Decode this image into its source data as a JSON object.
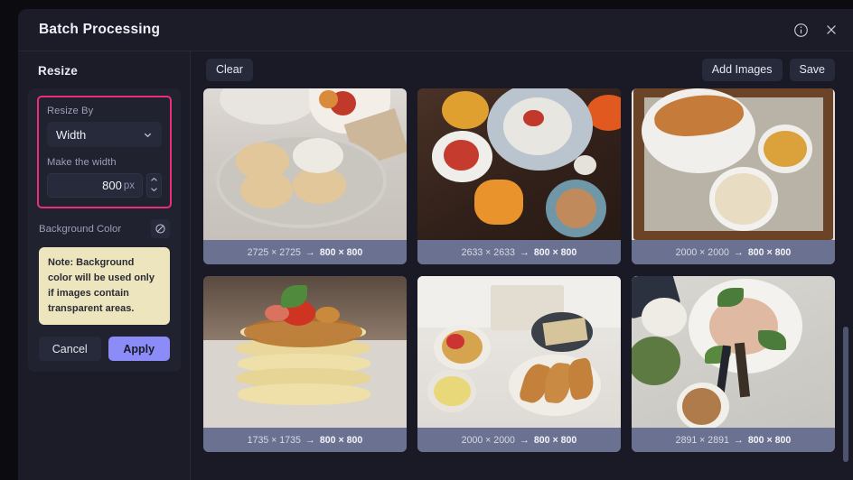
{
  "window": {
    "title": "Batch Processing",
    "info_icon": "info-circle-icon",
    "close_icon": "close-icon"
  },
  "sidebar": {
    "heading": "Resize",
    "resize_by": {
      "label": "Resize By",
      "selected": "Width",
      "chevron_icon": "chevron-down-icon"
    },
    "width_field": {
      "label": "Make the width",
      "value": "800",
      "unit": "px",
      "stepper_up_icon": "chevron-up-icon",
      "stepper_down_icon": "chevron-down-icon"
    },
    "background_color": {
      "label": "Background Color",
      "swatch_icon": "no-color-icon"
    },
    "note": "Note: Background color will be used only if images contain transparent areas.",
    "cancel_label": "Cancel",
    "apply_label": "Apply"
  },
  "toolbar": {
    "clear_label": "Clear",
    "add_images_label": "Add Images",
    "save_label": "Save"
  },
  "grid": {
    "arrow": "→",
    "items": [
      {
        "source": "2725 × 2725",
        "target": "800 × 800",
        "art": "a1",
        "alt": "scones-on-plate"
      },
      {
        "source": "2633 × 2633",
        "target": "800 × 800",
        "art": "a2",
        "alt": "brunch-flatlay-dark-wood"
      },
      {
        "source": "2000 × 2000",
        "target": "800 × 800",
        "art": "a3",
        "alt": "croissant-on-tray"
      },
      {
        "source": "1735 × 1735",
        "target": "800 × 800",
        "art": "a4",
        "alt": "pancake-stack-with-caramel"
      },
      {
        "source": "2000 × 2000",
        "target": "800 × 800",
        "art": "a5",
        "alt": "breakfast-table-waffles-croissants"
      },
      {
        "source": "2891 × 2891",
        "target": "800 × 800",
        "art": "a6",
        "alt": "salad-plate-on-marble"
      }
    ]
  },
  "colors": {
    "accent_highlight": "#ec2d7b",
    "apply_button": "#8b8cf7",
    "note_background": "#ece5bd",
    "window_background": "#1b1c28",
    "caption_background": "#6b7190"
  }
}
